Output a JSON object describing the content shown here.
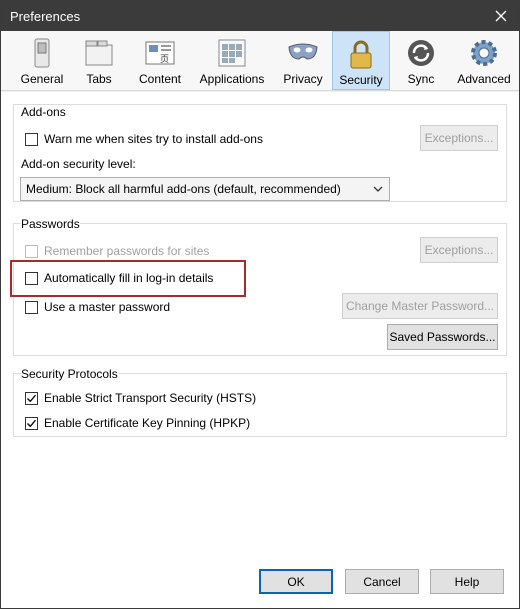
{
  "window": {
    "title": "Preferences"
  },
  "toolbar": {
    "tabs": [
      {
        "label": "General",
        "icon": "general-switch-icon"
      },
      {
        "label": "Tabs",
        "icon": "tabs-icon"
      },
      {
        "label": "Content",
        "icon": "content-icon"
      },
      {
        "label": "Applications",
        "icon": "applications-icon"
      },
      {
        "label": "Privacy",
        "icon": "privacy-mask-icon"
      },
      {
        "label": "Security",
        "icon": "padlock-icon",
        "active": true
      },
      {
        "label": "Sync",
        "icon": "sync-icon"
      },
      {
        "label": "Advanced",
        "icon": "gear-icon"
      }
    ]
  },
  "addons": {
    "title": "Add-ons",
    "warn_label": "Warn me when sites try to install add-ons",
    "exceptions_label": "Exceptions...",
    "security_level_label": "Add-on security level:",
    "security_level_value": "Medium: Block all harmful add-ons (default, recommended)"
  },
  "passwords": {
    "title": "Passwords",
    "remember_label": "Remember passwords for sites",
    "exceptions_label": "Exceptions...",
    "autofill_label": "Automatically fill in log-in details",
    "master_label": "Use a master password",
    "change_master_label": "Change Master Password...",
    "saved_label": "Saved Passwords..."
  },
  "protocols": {
    "title": "Security Protocols",
    "hsts_label": "Enable Strict Transport Security (HSTS)",
    "hpkp_label": "Enable Certificate Key Pinning (HPKP)"
  },
  "footer": {
    "ok": "OK",
    "cancel": "Cancel",
    "help": "Help"
  },
  "colors": {
    "accent": "#0a64b4",
    "highlight": "#a82a2a",
    "titlebar": "#3b3b3b"
  }
}
